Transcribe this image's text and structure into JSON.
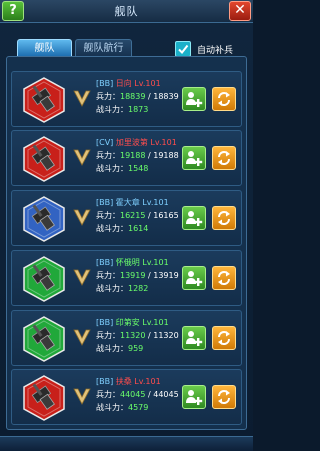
{
  "window": {
    "title": "舰队",
    "help": "?",
    "close": "✕"
  },
  "tabs": [
    {
      "label": "舰队",
      "active": true
    },
    {
      "label": "舰队航行",
      "active": false
    }
  ],
  "auto_supply": {
    "label": "自动补兵",
    "checked": true
  },
  "labels": {
    "hp_prefix": "兵力：",
    "power_prefix": "战斗力：",
    "sep": " / "
  },
  "colors": {
    "red": "#ff4d4d",
    "green": "#6bff6b",
    "cyan": "#7fd0ff",
    "hex_red": "#c8201a",
    "hex_blue": "#3263c2",
    "hex_green": "#21a83a"
  },
  "ships": [
    {
      "cls": "[BB]",
      "name": "日向 Lv.101",
      "name_color": "#ff4d4d",
      "hex": "red",
      "rank": "VI",
      "hp": "18839",
      "hp_max": "18839",
      "power": "1873",
      "hp_color": "#6bff6b"
    },
    {
      "cls": "[CV]",
      "name": "加里波第 Lv.101",
      "name_color": "#ff4d4d",
      "hex": "red",
      "rank": "VI",
      "hp": "19188",
      "hp_max": "19188",
      "power": "1548",
      "hp_color": "#6bff6b"
    },
    {
      "cls": "[BB]",
      "name": "霍大章 Lv.101",
      "name_color": "#7fd0ff",
      "hex": "blue",
      "rank": "VI",
      "hp": "16215",
      "hp_max": "16165",
      "power": "1614",
      "hp_color": "#6bff6b"
    },
    {
      "cls": "[BB]",
      "name": "怀俄明 Lv.101",
      "name_color": "#6bff6b",
      "hex": "green",
      "rank": "V",
      "hp": "13919",
      "hp_max": "13919",
      "power": "1282",
      "hp_color": "#6bff6b"
    },
    {
      "cls": "[BB]",
      "name": "印第安 Lv.101",
      "name_color": "#6bff6b",
      "hex": "green",
      "rank": "II",
      "hp": "11320",
      "hp_max": "11320",
      "power": "959",
      "hp_color": "#6bff6b"
    },
    {
      "cls": "[BB]",
      "name": "扶桑 Lv.101",
      "name_color": "#ff4d4d",
      "hex": "red",
      "rank": "X",
      "hp": "44045",
      "hp_max": "44045",
      "power": "4579",
      "hp_color": "#6bff6b"
    }
  ]
}
